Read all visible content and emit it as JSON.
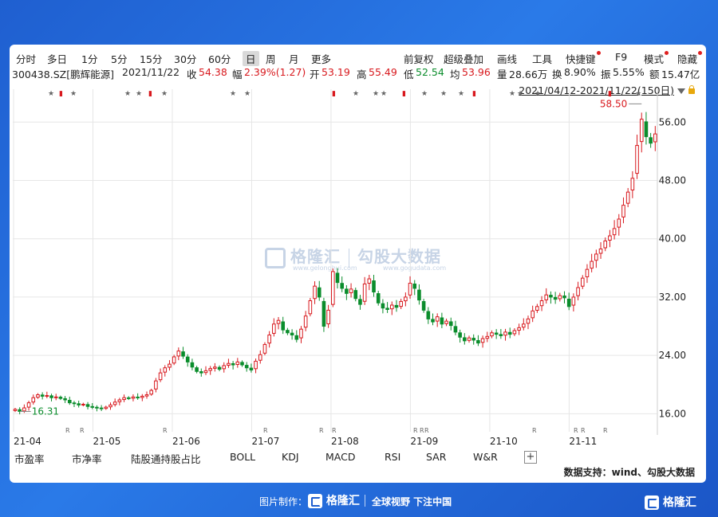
{
  "toolbar": {
    "periods": [
      "分时",
      "多日",
      "1分",
      "5分",
      "15分",
      "30分",
      "60分",
      "日",
      "周",
      "月",
      "更多"
    ],
    "active": "日",
    "right": [
      "前复权",
      "超级叠加",
      "画线",
      "工具",
      "快捷键",
      "F9",
      "模式",
      "隐藏"
    ]
  },
  "info": {
    "code": "300438.SZ[鹏辉能源]",
    "date": "2021/11/22",
    "close_label": "收",
    "close": "54.38",
    "chg_label": "幅",
    "chg": "2.39%(1.27)",
    "open_label": "开",
    "open": "53.19",
    "high_label": "高",
    "high": "55.49",
    "low_label": "低",
    "low": "52.54",
    "avg_label": "均",
    "avg": "53.96",
    "vol_label": "量",
    "vol": "28.66万",
    "turn_label": "换",
    "turn": "8.90%",
    "amp_label": "振",
    "amp": "5.55%",
    "amt_label": "额",
    "amt": "15.47亿"
  },
  "range": "2021/04/12-2021/11/22(150日)",
  "indicators": [
    "市盈率",
    "市净率",
    "陆股通持股占比",
    "BOLL",
    "KDJ",
    "MACD",
    "RSI",
    "SAR",
    "W&R"
  ],
  "source": "数据支持：wind、勾股大数据",
  "footer": {
    "made_by": "图片制作：",
    "logo": "格隆汇",
    "slogan": "全球视野 下注中国",
    "corner": "格隆汇"
  },
  "watermark": {
    "brand": "格隆汇",
    "brand_url": "www.gelonghui.com",
    "partner": "勾股大数据",
    "partner_url": "www.gogudata.com"
  },
  "colors": {
    "up": "#d8191e",
    "down": "#0b8d2c",
    "grid": "#e6e6e6"
  },
  "chart_data": {
    "type": "candlestick",
    "y_ticks": [
      16.0,
      24.0,
      32.0,
      40.0,
      48.0,
      56.0
    ],
    "ylim": [
      14.4,
      59.2
    ],
    "x_ticks": [
      "21-04",
      "21-05",
      "21-06",
      "21-07",
      "21-08",
      "21-09",
      "21-10",
      "21-11"
    ],
    "annotations": {
      "max_label": "58.50",
      "min_label": "16.31",
      "max_value": 58.5,
      "min_value": 16.31
    },
    "close_series": [
      16.6,
      16.31,
      16.8,
      17.5,
      18.2,
      18.6,
      18.4,
      18.5,
      18.2,
      18.3,
      18.1,
      17.9,
      17.5,
      17.4,
      17.2,
      17.3,
      17.0,
      16.9,
      16.8,
      16.7,
      16.9,
      17.2,
      17.6,
      17.9,
      18.2,
      18.1,
      18.3,
      18.2,
      18.4,
      18.6,
      19.2,
      20.5,
      21.6,
      22.3,
      22.8,
      23.8,
      24.6,
      23.9,
      23.1,
      22.4,
      21.8,
      21.6,
      21.9,
      22.2,
      22.4,
      22.1,
      22.6,
      22.9,
      22.7,
      23.1,
      22.7,
      22.3,
      22.0,
      23.2,
      24.1,
      25.5,
      26.8,
      28.3,
      28.8,
      27.5,
      27.1,
      26.8,
      26.2,
      27.6,
      29.4,
      31.5,
      33.5,
      32.0,
      28.0,
      30.2,
      35.5,
      34.0,
      33.2,
      32.5,
      33.1,
      31.8,
      31.0,
      33.8,
      34.5,
      32.7,
      31.2,
      30.5,
      30.3,
      30.9,
      30.6,
      31.4,
      32.0,
      33.9,
      33.2,
      31.6,
      30.2,
      29.0,
      28.6,
      29.3,
      28.3,
      28.7,
      28.1,
      27.2,
      26.5,
      26.0,
      26.4,
      26.1,
      25.7,
      26.3,
      26.6,
      27.1,
      26.9,
      26.7,
      27.2,
      26.9,
      27.4,
      27.8,
      28.3,
      29.0,
      30.1,
      30.7,
      31.5,
      32.3,
      32.0,
      31.7,
      32.2,
      31.9,
      30.7,
      32.0,
      33.3,
      34.6,
      35.8,
      36.9,
      37.9,
      38.6,
      39.7,
      40.4,
      41.4,
      42.7,
      44.6,
      46.4,
      48.3,
      52.8,
      56.4,
      54.0,
      53.11,
      54.38
    ]
  }
}
